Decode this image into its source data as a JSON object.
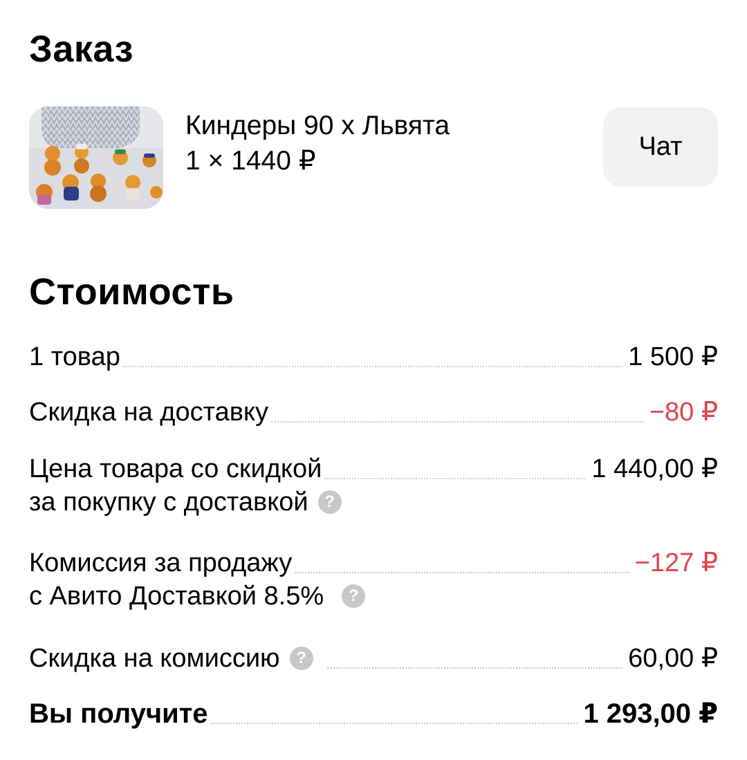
{
  "order": {
    "title": "Заказ",
    "product_name": "Киндеры 90 х Львята",
    "product_qty_price": "1 × 1440 ₽",
    "chat_label": "Чат"
  },
  "cost": {
    "title": "Стоимость",
    "rows": [
      {
        "label": "1 товар",
        "value": "1 500 ₽"
      },
      {
        "label": "Скидка на доставку",
        "value": "−80 ₽"
      },
      {
        "label_line1": "Цена товара со скидкой",
        "label_line2": "за покупку с доставкой",
        "value": "1 440,00 ₽"
      },
      {
        "label_line1": "Комиссия за продажу",
        "label_line2": "с Авито Доставкой 8.5%",
        "value": "−127 ₽"
      },
      {
        "label": "Скидка на комиссию",
        "value": "60,00 ₽"
      },
      {
        "label": "Вы получите",
        "value": "1 293,00 ₽"
      }
    ]
  },
  "icons": {
    "help": "question-circle-icon",
    "help_glyph": "?"
  },
  "colors": {
    "negative": "#e0444d",
    "chat_button_bg": "#f2f1f0"
  }
}
